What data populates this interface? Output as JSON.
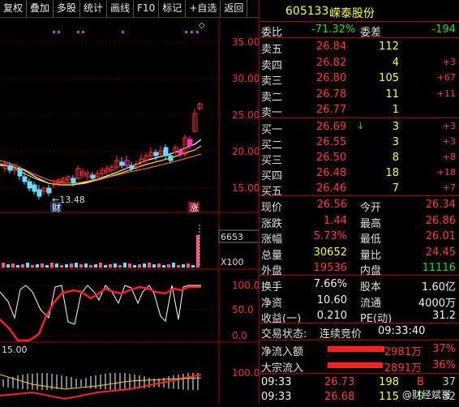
{
  "toolbar": [
    "复权",
    "叠加",
    "多股",
    "统计",
    "画线",
    "F10",
    "标记",
    "+自选",
    "返回"
  ],
  "chart": {
    "price_ticks": [
      "35.00",
      "30.00",
      "25.00",
      "20.00",
      "15.00"
    ],
    "low_label": "13.48",
    "fin_badge": "财",
    "up_badge": "涨",
    "vol_label": "6653",
    "vol_unit": "X100",
    "kdj_ticks": [
      "100.0",
      "50.0",
      "0.0"
    ],
    "bottom_left": "15.00",
    "bottom_tick": "100.0"
  },
  "stock": {
    "code": "605133",
    "name": "嵘泰股份"
  },
  "wei": {
    "wb_label": "委比",
    "wb_value": "-71.32%",
    "wc_label": "委差",
    "wc_value": "-194"
  },
  "sells": [
    {
      "label": "卖五",
      "price": "26.84",
      "vol": "112",
      "chg": ""
    },
    {
      "label": "卖四",
      "price": "26.82",
      "vol": "4",
      "chg": "+3"
    },
    {
      "label": "卖三",
      "price": "26.80",
      "vol": "105",
      "chg": "+67"
    },
    {
      "label": "卖二",
      "price": "26.78",
      "vol": "11",
      "chg": "+11"
    },
    {
      "label": "卖一",
      "price": "26.77",
      "vol": "1",
      "chg": ""
    }
  ],
  "buys": [
    {
      "label": "买一",
      "price": "26.69",
      "arrow": "↓",
      "vol": "3",
      "chg": "+3"
    },
    {
      "label": "买二",
      "price": "26.55",
      "arrow": "",
      "vol": "3",
      "chg": "+3"
    },
    {
      "label": "买三",
      "price": "26.50",
      "arrow": "",
      "vol": "8",
      "chg": "+8"
    },
    {
      "label": "买四",
      "price": "26.48",
      "arrow": "",
      "vol": "18",
      "chg": "+18"
    },
    {
      "label": "买五",
      "price": "26.46",
      "arrow": "",
      "vol": "7",
      "chg": "+7"
    }
  ],
  "quote": [
    {
      "l1": "现价",
      "v1": "26.56",
      "c1": "red",
      "l2": "今开",
      "v2": "26.34",
      "c2": "red"
    },
    {
      "l1": "涨跌",
      "v1": "1.44",
      "c1": "red",
      "l2": "最高",
      "v2": "26.86",
      "c2": "red"
    },
    {
      "l1": "涨幅",
      "v1": "5.73%",
      "c1": "red",
      "l2": "最低",
      "v2": "26.01",
      "c2": "red"
    },
    {
      "l1": "总量",
      "v1": "30652",
      "c1": "yellow",
      "l2": "量比",
      "v2": "24.45",
      "c2": "red"
    },
    {
      "l1": "外盘",
      "v1": "19536",
      "c1": "red",
      "l2": "内盘",
      "v2": "11116",
      "c2": "green"
    }
  ],
  "stats": [
    {
      "l1": "换手",
      "v1": "7.66%",
      "l2": "股本",
      "v2": "1.60亿"
    },
    {
      "l1": "净资",
      "v1": "10.60",
      "l2": "流通",
      "v2": "4000万"
    },
    {
      "l1": "收益(一)",
      "v1": "0.210",
      "l2": "PE(动)",
      "v2": "31.2"
    }
  ],
  "status": {
    "label": "交易状态:",
    "value": "连续竞价",
    "time": "09:33:40"
  },
  "flows": [
    {
      "label": "净流入额",
      "amount": "2981万",
      "pct": "37%",
      "fill": 0.37
    },
    {
      "label": "大宗流入",
      "amount": "2891万",
      "pct": "36%",
      "fill": 0.36
    }
  ],
  "ticks": [
    {
      "time": "09:33",
      "price": "26.73",
      "vol": "198",
      "dir": "B",
      "num": "37"
    },
    {
      "time": "09:33",
      "price": "26.68",
      "vol": "115",
      "dir": "S",
      "num": "32"
    }
  ],
  "watermark": "@财经斌哥"
}
